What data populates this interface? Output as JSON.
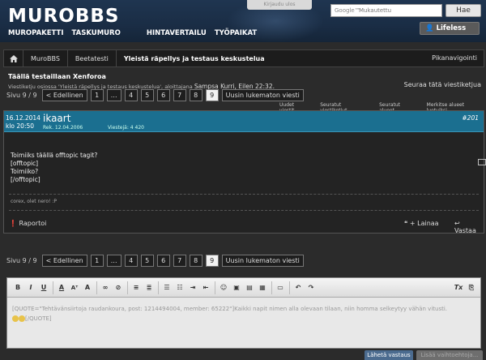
{
  "header": {
    "logo": "MUROBBS",
    "nav": [
      "MUROPAKETTI",
      "TASKUMURO",
      "HINTAVERTAILU",
      "TYÖPAIKAT"
    ],
    "login_tab": "Kirjaudu ulos",
    "search_brand": "Google™",
    "search_placeholder": "Mukautettu",
    "search_button": "Hae",
    "user": "Lifeless"
  },
  "breadcrumb": {
    "items": [
      "MuroBBS",
      "Beetatesti",
      "Yleistä räpellys ja testaus keskustelua"
    ],
    "quick_nav": "Pikanavigointi"
  },
  "thread": {
    "title": "Täällä testaillaan Xenforoa",
    "desc_prefix": "Viestiketju osiossa 'Yleistä räpellys ja testaus keskustelua', aloittajana",
    "desc_author": "Sampsa Kurri, Eilen 22:32.",
    "follow": "Seuraa tätä viestiketjua"
  },
  "pager": {
    "label": "Sivu 9 / 9",
    "prev": "< Edellinen",
    "pages": [
      "1",
      "…",
      "4",
      "5",
      "6",
      "7",
      "8",
      "9"
    ],
    "current": "9",
    "next": "Uusin lukematon viesti"
  },
  "quicklinks": [
    "Uudet viestit",
    "Seuratut viestiketjut",
    "Seuratut alueet",
    "Merkitse alueet luetuiksi"
  ],
  "post": {
    "date": "16.12.2014",
    "time": "klo 20:50",
    "author": "ikaart",
    "registered": "Rek. 12.04.2006",
    "messages": "Viestejä: 4 420",
    "number": "#201",
    "body": [
      "Toimiiks täällä offtopic tagit?",
      "[offtopic]",
      "Toimiiko?",
      "[/offtopic]"
    ],
    "signature": "corex, olet nero! :P",
    "report": "Raportoi",
    "quote": "+ Lainaa",
    "reply": "Vastaa"
  },
  "editor": {
    "content": "[QUOTE=\"Tehtävänsiirtoja raudankoura, post: 1214494004, member: 65222\"]Kaikki napit nimen alla olevaan tilaan, niin homma selkeytyy vähän vitusti.",
    "content_end": "[/QUOTE]",
    "submit": "Lähetä vastaus",
    "more": "Lisää vaihtoehtoja..."
  }
}
